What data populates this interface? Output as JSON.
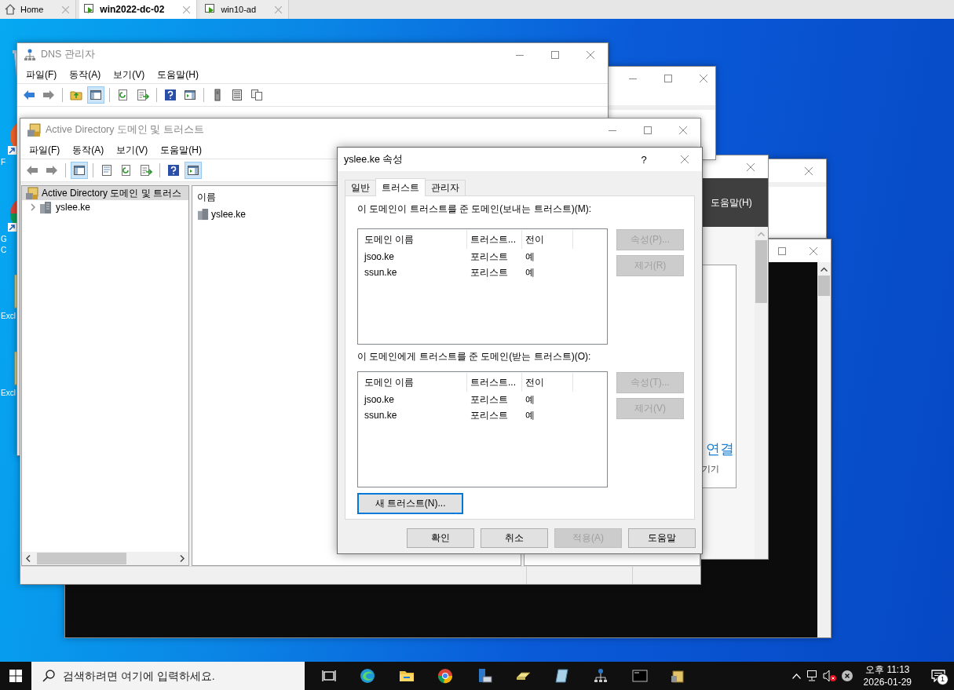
{
  "host_tabs": [
    {
      "label": "Home",
      "kind": "home",
      "selected": false
    },
    {
      "label": "win2022-dc-02",
      "kind": "vm",
      "selected": true
    },
    {
      "label": "win10-ad",
      "kind": "vm",
      "selected": false
    }
  ],
  "desktop_icons": [
    {
      "kind": "trash"
    },
    {
      "kind": "firefox",
      "lines": [
        "F"
      ]
    },
    {
      "kind": "chrome",
      "lines": [
        "G",
        "C"
      ]
    },
    {
      "kind": "excel",
      "lines": [
        "Excl"
      ]
    },
    {
      "kind": "excel",
      "lines": [
        "Excl"
      ]
    }
  ],
  "side_window": {
    "menu_item": "도움말(H)",
    "link": "연결",
    "text": "기기"
  },
  "dns_window": {
    "title": "DNS 관리자",
    "menu": [
      "파일(F)",
      "동작(A)",
      "보기(V)",
      "도움말(H)"
    ],
    "toolbar": [
      [
        {
          "kind": "back",
          "disabled": false
        },
        {
          "kind": "forward",
          "disabled": true
        }
      ],
      [
        {
          "kind": "folder_up",
          "pressed": false
        },
        {
          "kind": "console_tree",
          "pressed": true
        }
      ],
      [
        {
          "kind": "refresh",
          "pressed": false
        },
        {
          "kind": "export",
          "pressed": false
        }
      ],
      [
        {
          "kind": "help",
          "pressed": false
        },
        {
          "kind": "action_pane",
          "pressed": false
        }
      ],
      [
        {
          "kind": "server",
          "pressed": false
        },
        {
          "kind": "list",
          "pressed": false
        },
        {
          "kind": "copy",
          "pressed": false
        }
      ]
    ]
  },
  "ad_window": {
    "title": "Active Directory 도메인 및 트러스트",
    "menu": [
      "파일(F)",
      "동작(A)",
      "보기(V)",
      "도움말(H)"
    ],
    "toolbar": [
      [
        {
          "kind": "back",
          "disabled": true
        },
        {
          "kind": "forward",
          "disabled": true
        }
      ],
      [
        {
          "kind": "console_tree",
          "pressed": true
        }
      ],
      [
        {
          "kind": "properties",
          "pressed": false
        },
        {
          "kind": "refresh",
          "pressed": false
        },
        {
          "kind": "export",
          "pressed": false
        }
      ],
      [
        {
          "kind": "help",
          "pressed": false
        },
        {
          "kind": "action_pane",
          "pressed": true
        }
      ]
    ],
    "tree": [
      {
        "label": "Active Directory 도메인 및 트러스",
        "selected": true,
        "children": [
          {
            "label": "yslee.ke",
            "selected": false,
            "expanded": false
          }
        ]
      }
    ],
    "list": {
      "column": "이름",
      "rows": [
        "yslee.ke"
      ]
    }
  },
  "dialog": {
    "title": "yslee.ke 속성",
    "help": "?",
    "tabs": [
      {
        "label": "일반",
        "selected": false
      },
      {
        "label": "트러스트",
        "selected": true
      },
      {
        "label": "관리자",
        "selected": false
      }
    ],
    "sections": [
      {
        "label": "이 도메인이 트러스트를 준 도메인(보내는 트러스트)(M):",
        "columns": [
          "도메인 이름",
          "트러스트...",
          "전이"
        ],
        "rows": [
          [
            "jsoo.ke",
            "포리스트",
            "예"
          ],
          [
            "ssun.ke",
            "포리스트",
            "예"
          ]
        ],
        "buttons": [
          {
            "label": "속성(P)...",
            "disabled": true
          },
          {
            "label": "제거(R)",
            "disabled": true
          }
        ]
      },
      {
        "label": "이 도메인에게 트러스트를 준 도메인(받는 트러스트)(O):",
        "columns": [
          "도메인 이름",
          "트러스트...",
          "전이"
        ],
        "rows": [
          [
            "jsoo.ke",
            "포리스트",
            "예"
          ],
          [
            "ssun.ke",
            "포리스트",
            "예"
          ]
        ],
        "buttons": [
          {
            "label": "속성(T)...",
            "disabled": true
          },
          {
            "label": "제거(V)",
            "disabled": true
          }
        ]
      }
    ],
    "new_trust": {
      "label": "새 트러스트(N)...",
      "focused": true
    },
    "buttons": [
      {
        "label": "확인",
        "disabled": false
      },
      {
        "label": "취소",
        "disabled": false
      },
      {
        "label": "적용(A)",
        "disabled": true
      },
      {
        "label": "도움말",
        "disabled": false
      }
    ]
  },
  "taskbar": {
    "search_placeholder": "검색하려면 여기에 입력하세요.",
    "apps": [
      {
        "kind": "task_view"
      },
      {
        "kind": "edge"
      },
      {
        "kind": "folder"
      },
      {
        "kind": "chrome"
      },
      {
        "kind": "server"
      },
      {
        "kind": "drive"
      },
      {
        "kind": "notebook"
      },
      {
        "kind": "network"
      },
      {
        "kind": "terminal"
      },
      {
        "kind": "building"
      }
    ],
    "time": "오후 11:13",
    "date": "2026-01-29",
    "notification_count": "1"
  }
}
